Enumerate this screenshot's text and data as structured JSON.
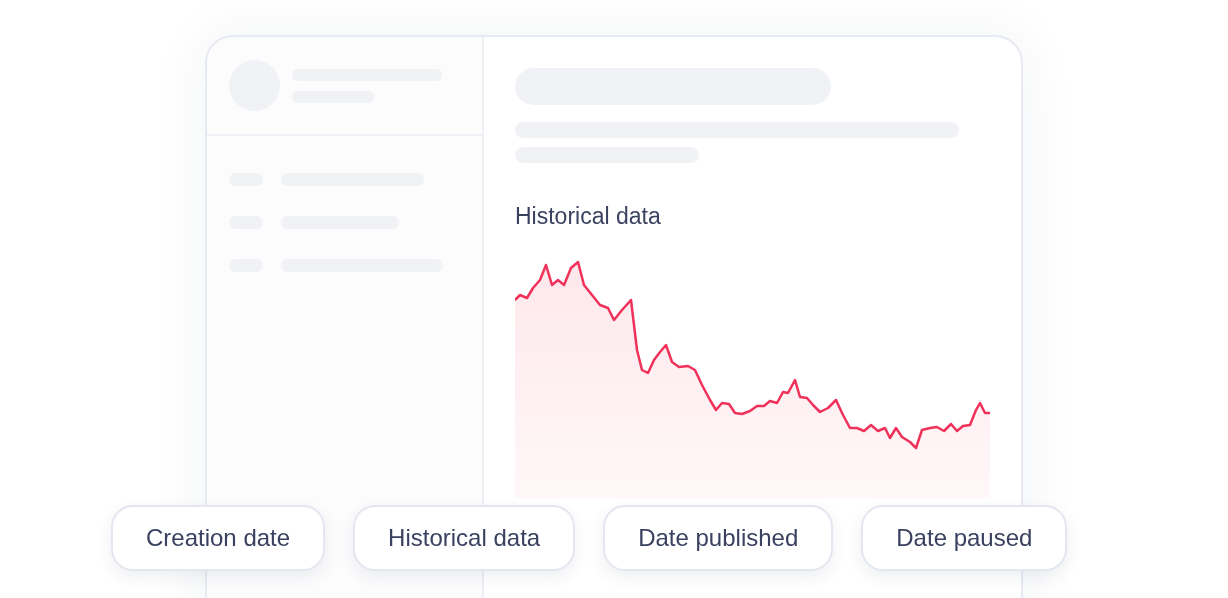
{
  "main": {
    "section_title": "Historical data"
  },
  "filters": [
    {
      "label": "Creation date"
    },
    {
      "label": "Historical data"
    },
    {
      "label": "Date published"
    },
    {
      "label": "Date paused"
    }
  ]
}
